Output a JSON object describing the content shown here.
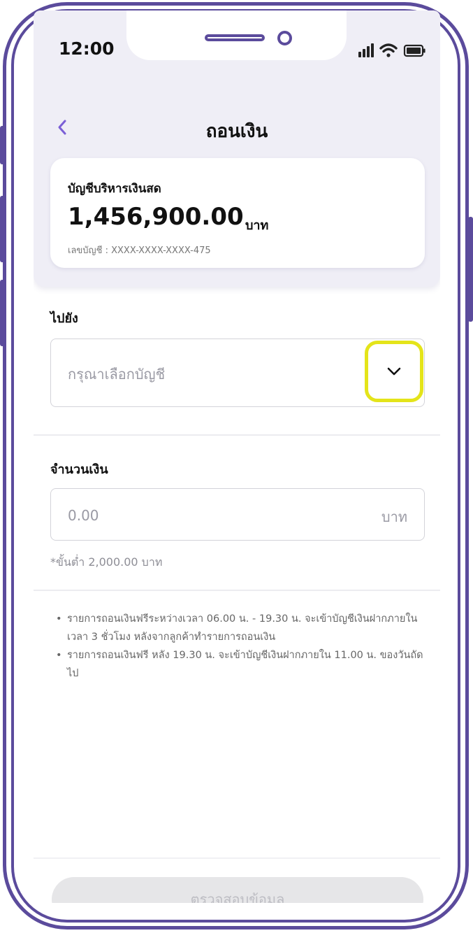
{
  "status_bar": {
    "time": "12:00",
    "icons": [
      "signal-icon",
      "wifi-icon",
      "battery-icon"
    ]
  },
  "header": {
    "back_icon": "chevron-left-icon",
    "title": "ถอนเงิน"
  },
  "account": {
    "name": "บัญชีบริหารเงินสด",
    "balance": "1,456,900.00",
    "currency": "บาท",
    "number_label": "เลขบัญชี :",
    "number": "XXXX-XXXX-XXXX-475"
  },
  "destination": {
    "label": "ไปยัง",
    "placeholder": "กรุณาเลือกบัญชี",
    "dropdown_icon": "chevron-down-icon"
  },
  "amount": {
    "label": "จำนวนเงิน",
    "placeholder": "0.00",
    "unit": "บาท",
    "minimum_note": "*ขั้นต่ำ 2,000.00 บาท"
  },
  "notes": [
    "รายการถอนเงินฟรีระหว่างเวลา 06.00 น. - 19.30 น. จะเข้าบัญชีเงินฝากภายใน เวลา 3 ชั่วโมง หลังจากลูกค้าทำรายการถอนเงิน",
    "รายการถอนเงินฟรี หลัง 19.30 น. จะเข้าบัญชีเงินฝากภายใน 11.00 น. ของวันถัดไป"
  ],
  "footer": {
    "confirm_label": "ตรวจสอบข้อมูล"
  },
  "colors": {
    "frame": "#5b4b9c",
    "accent": "#7b5fd6",
    "highlight": "#e4e41a",
    "header_bg": "#efeef6"
  }
}
